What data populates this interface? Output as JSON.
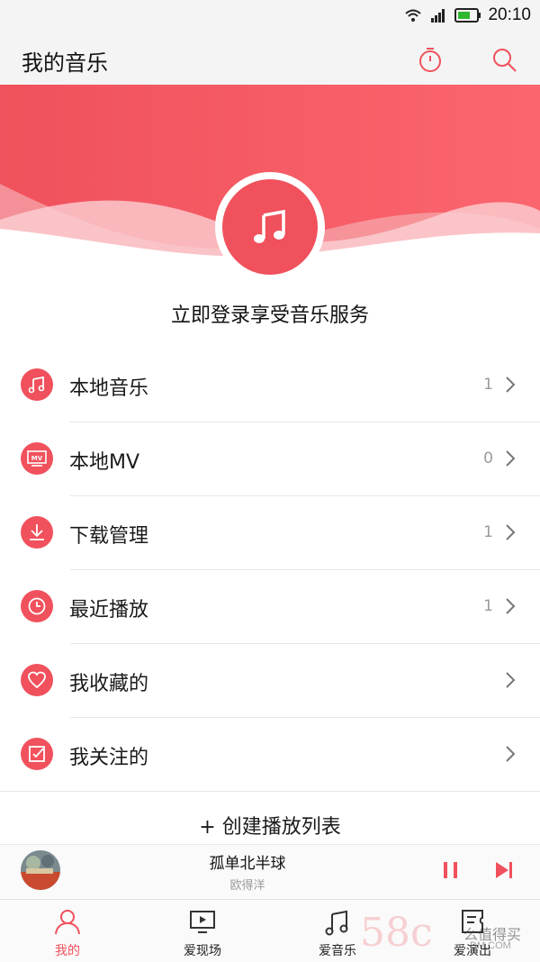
{
  "status_bar": {
    "time": "20:10"
  },
  "header": {
    "title": "我的音乐",
    "timer_icon": "timer-icon",
    "search_icon": "search-icon"
  },
  "banner": {
    "login_prompt": "立即登录享受音乐服务",
    "music_icon": "music-note-icon",
    "accent": "#f0515c"
  },
  "list": {
    "items": [
      {
        "label": "本地音乐",
        "count": "1",
        "icon": "music-note-icon"
      },
      {
        "label": "本地MV",
        "count": "0",
        "icon": "mv-icon"
      },
      {
        "label": "下载管理",
        "count": "1",
        "icon": "download-icon"
      },
      {
        "label": "最近播放",
        "count": "1",
        "icon": "clock-icon"
      },
      {
        "label": "我收藏的",
        "count": "",
        "icon": "heart-icon"
      },
      {
        "label": "我关注的",
        "count": "",
        "icon": "check-box-icon"
      }
    ],
    "create_playlist": "+ 创建播放列表"
  },
  "player": {
    "song": "孤单北半球",
    "artist": "欧得洋"
  },
  "bottom_nav": [
    {
      "label": "我的",
      "icon": "person-icon",
      "active": true
    },
    {
      "label": "爱现场",
      "icon": "tv-icon",
      "active": false
    },
    {
      "label": "爱音乐",
      "icon": "music-note-icon",
      "active": false
    },
    {
      "label": "爱演出",
      "icon": "ticket-icon",
      "active": false
    }
  ],
  "watermark": {
    "main": "58c",
    "site_top": "么值得买",
    "site_bottom": "DM.COM"
  }
}
